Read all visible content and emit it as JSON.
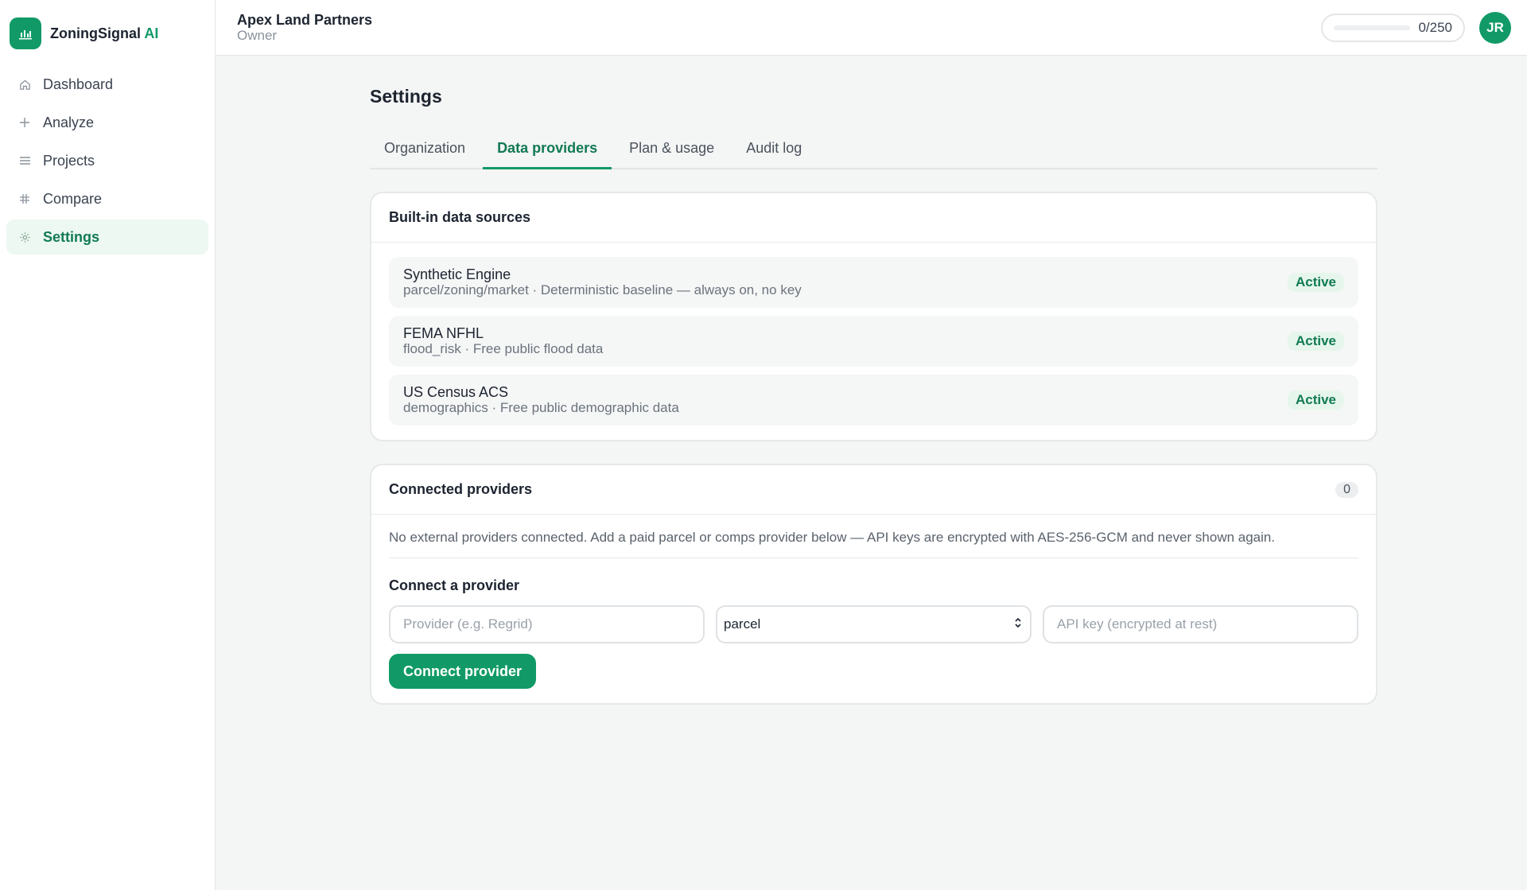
{
  "brand": {
    "name": "ZoningSignal",
    "suffix": "AI",
    "icon": "bar-chart-icon"
  },
  "sidebar": {
    "items": [
      {
        "label": "Dashboard",
        "icon": "home-icon",
        "active": false
      },
      {
        "label": "Analyze",
        "icon": "plus-icon",
        "active": false
      },
      {
        "label": "Projects",
        "icon": "list-icon",
        "active": false
      },
      {
        "label": "Compare",
        "icon": "grid-icon",
        "active": false
      },
      {
        "label": "Settings",
        "icon": "gear-icon",
        "active": true
      }
    ]
  },
  "header": {
    "org_name": "Apex Land Partners",
    "role": "Owner",
    "usage": {
      "text": "0/250",
      "used": 0,
      "limit": 250
    },
    "avatar_initials": "JR"
  },
  "page": {
    "title": "Settings"
  },
  "tabs": [
    {
      "label": "Organization",
      "active": false
    },
    {
      "label": "Data providers",
      "active": true
    },
    {
      "label": "Plan & usage",
      "active": false
    },
    {
      "label": "Audit log",
      "active": false
    }
  ],
  "builtin": {
    "title": "Built-in data sources",
    "sources": [
      {
        "name": "Synthetic Engine",
        "desc": "parcel/zoning/market · Deterministic baseline — always on, no key",
        "status": "Active"
      },
      {
        "name": "FEMA NFHL",
        "desc": "flood_risk · Free public flood data",
        "status": "Active"
      },
      {
        "name": "US Census ACS",
        "desc": "demographics · Free public demographic data",
        "status": "Active"
      }
    ]
  },
  "connected": {
    "title": "Connected providers",
    "count": "0",
    "note": "No external providers connected. Add a paid parcel or comps provider below — API keys are encrypted with AES-256-GCM and never shown again.",
    "form": {
      "label": "Connect a provider",
      "provider_placeholder": "Provider (e.g. Regrid)",
      "type_value": "parcel",
      "key_placeholder": "API key (encrypted at rest)",
      "submit_label": "Connect provider"
    }
  },
  "colors": {
    "accent": "#119a67",
    "accent_dark": "#117a54",
    "active_bg": "#ecf8f1"
  }
}
